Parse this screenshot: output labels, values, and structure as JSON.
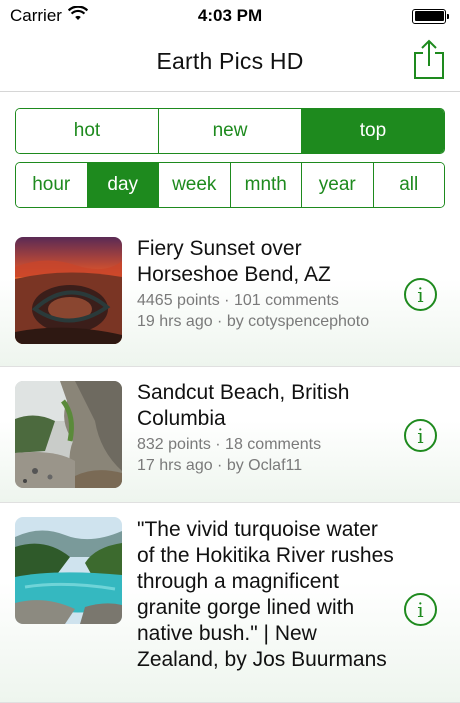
{
  "status": {
    "carrier": "Carrier",
    "time": "4:03 PM",
    "wifi_icon": "wifi-icon",
    "battery_icon": "battery-icon"
  },
  "nav": {
    "title": "Earth Pics HD",
    "share_icon": "share-icon"
  },
  "sort_tabs": [
    {
      "label": "hot",
      "selected": false
    },
    {
      "label": "new",
      "selected": false
    },
    {
      "label": "top",
      "selected": true
    }
  ],
  "time_tabs": [
    {
      "label": "hour",
      "selected": false
    },
    {
      "label": "day",
      "selected": true
    },
    {
      "label": "week",
      "selected": false
    },
    {
      "label": "mnth",
      "selected": false
    },
    {
      "label": "year",
      "selected": false
    },
    {
      "label": "all",
      "selected": false
    }
  ],
  "posts": [
    {
      "title": "Fiery Sunset over Horseshoe Bend, AZ",
      "meta_line1": "4465 points · 101 comments",
      "meta_line2": "19 hrs ago · by cotyspencephoto",
      "thumbnail": "sunset-canyon-photo"
    },
    {
      "title": "Sandcut Beach, British Columbia",
      "meta_line1": "832 points · 18 comments",
      "meta_line2": "17 hrs ago · by Oclaf11",
      "thumbnail": "rocky-beach-photo"
    },
    {
      "title": "\"The vivid turquoise water of the Hokitika River rushes through a magnificent granite gorge lined with native bush.\" | New Zealand, by Jos Buurmans",
      "meta_line1": "",
      "meta_line2": "",
      "thumbnail": "turquoise-river-photo"
    }
  ],
  "info_glyph": "i",
  "colors": {
    "accent": "#1e8a1e",
    "meta_text": "#7a7a7a"
  }
}
